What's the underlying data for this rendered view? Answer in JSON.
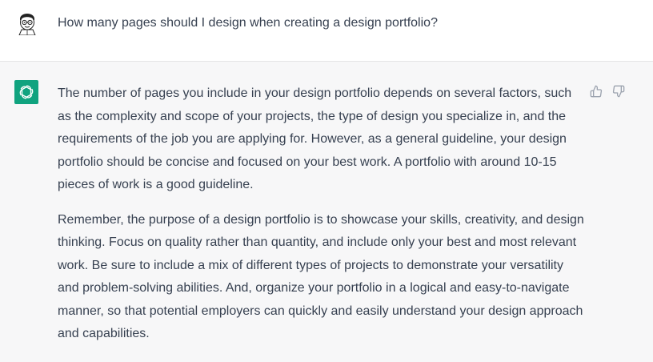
{
  "conversation": {
    "user_message": "How many pages should I design when creating a design portfolio?",
    "assistant_paragraphs": [
      "The number of pages you include in your design portfolio depends on several factors, such as the complexity and scope of your projects, the type of design you specialize in, and the requirements of the job you are applying for. However, as a general guideline, your design portfolio should be concise and focused on your best work. A portfolio with around 10-15 pieces of work is a good guideline.",
      "Remember, the purpose of a design portfolio is to showcase your skills, creativity, and design thinking. Focus on quality rather than quantity, and include only your best and most relevant work. Be sure to include a mix of different types of projects to demonstrate your versatility and problem-solving abilities. And, organize your portfolio in a logical and easy-to-navigate manner, so that potential employers can quickly and easily understand your design approach and capabilities."
    ]
  },
  "icons": {
    "user_avatar": "cartoon-user-avatar-icon",
    "assistant_avatar": "openai-logo-icon",
    "thumbs_up": "thumbs-up-icon",
    "thumbs_down": "thumbs-down-icon"
  },
  "colors": {
    "assistant_avatar_bg": "#10a37f",
    "user_row_bg": "#ffffff",
    "assistant_row_bg": "#f7f7f8",
    "text": "#374151"
  }
}
